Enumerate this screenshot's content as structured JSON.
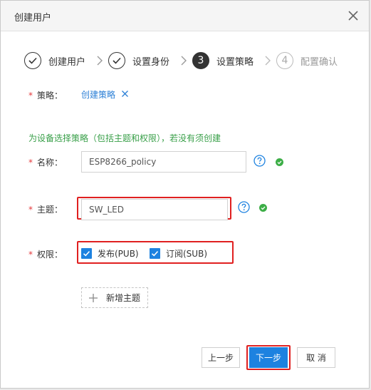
{
  "dialog": {
    "title": "创建用户"
  },
  "steps": [
    {
      "label": "创建用户",
      "state": "done"
    },
    {
      "label": "设置身份",
      "state": "done"
    },
    {
      "label": "设置策略",
      "state": "active",
      "number": "3"
    },
    {
      "label": "配置确认",
      "state": "todo",
      "number": "4"
    }
  ],
  "policy": {
    "label": "策略：",
    "link": "创建策略"
  },
  "hint": "为设备选择策略（包括主题和权限），若没有须创建",
  "name_field": {
    "label": "名称：",
    "value": "ESP8266_policy"
  },
  "topic_field": {
    "label": "主题：",
    "value": "SW_LED"
  },
  "permission": {
    "label": "权限：",
    "options": [
      {
        "label": "发布(PUB)",
        "checked": true
      },
      {
        "label": "订阅(SUB)",
        "checked": true
      }
    ]
  },
  "add_topic": "新增主题",
  "buttons": {
    "prev": "上一步",
    "next": "下一步",
    "cancel": "取 消"
  },
  "colors": {
    "primary": "#1d82e0",
    "success": "#3dae47",
    "required": "#e4393c",
    "highlight": "#e02020",
    "link": "#2b7fd6"
  }
}
